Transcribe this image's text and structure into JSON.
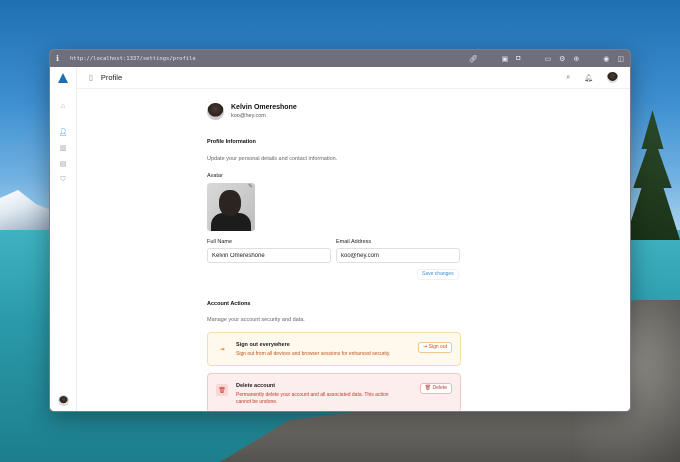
{
  "browser": {
    "info_icon": "info-icon",
    "url": "http://localhost:1337/settings/profile"
  },
  "topbar": {
    "title": "Profile"
  },
  "profile": {
    "name": "Kelvin Omereshone",
    "email": "koo@hey.com"
  },
  "profile_information": {
    "title": "Profile Information",
    "description": "Update your personal details and contact information.",
    "avatar_label": "Avatar",
    "full_name_label": "Full Name",
    "full_name_value": "Kelvin Omereshone",
    "email_label": "Email Address",
    "email_value": "koo@hey.com",
    "save_label": "Save changes"
  },
  "account_actions": {
    "title": "Account Actions",
    "description": "Manage your account security and data.",
    "sign_out": {
      "title": "Sign out everywhere",
      "description": "Sign out from all devices and browser sessions for enhanced security.",
      "button": "Sign out"
    },
    "delete": {
      "title": "Delete account",
      "description": "Permanently delete your account and all associated data. This action cannot be undone.",
      "button": "Delete"
    }
  },
  "colors": {
    "accent": "#2a85c8",
    "warning_bg": "#fff8ec",
    "danger_bg": "#fdeeee",
    "danger_text": "#c0392b",
    "warning_text": "#c0551a"
  }
}
